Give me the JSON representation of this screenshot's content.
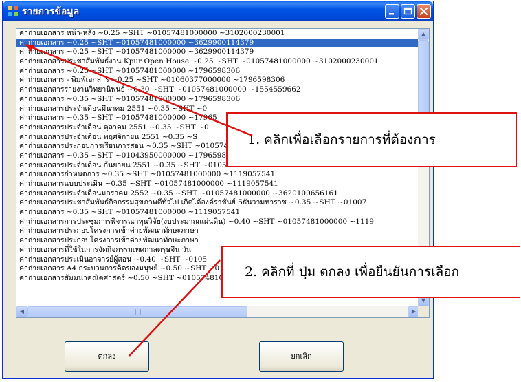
{
  "window": {
    "title": "รายการข้อมูล"
  },
  "list": {
    "selected_index": 1,
    "items": [
      "ค่าถ่ายเอกสาร หน้า-หลัง ~0.25 ~SHT ~01057481000000 ~3102000230001",
      "ค่าถ่ายเอกสาร ~0.25 ~SHT ~01057481000000 ~3629900114379",
      "ค่าถ่ายเอกสาร ~0.25 ~SHT ~01057481000000 ~3629900114379",
      "ค่าถ่ายเอกสารประชาสัมพันธ์งาน Kpur Open House ~0.25 ~SHT ~01057481000000 ~3102000230001",
      "ค่าถ่ายเอกสาร ~0.25 ~SHT ~01057481000000 ~1796598306",
      "ค่าถ่ายเอกสาร - พิมพ์เอกสาร ~0.25 ~SHT ~01060377000000 ~1796598306",
      "ค่าถ่ายเอกสารรายงานวิทยานิพนธ์ ~0.30 ~SHT ~01057481000000 ~1554559662",
      "ค่าถ่ายเอกสาร ~0.35 ~SHT ~01057481000000 ~1796598306",
      "ค่าถ่ายเอกสารประจำเดือนมีนาคม 2551 ~0.35 ~SHT ~0",
      "ค่าถ่ายเอกสาร ~0.35 ~SHT ~01057481000000 ~17965",
      "ค่าถ่ายเอกสารประจำเดือน ตุลาคม 2551 ~0.35 ~SHT ~0",
      "ค่าถ่ายเอกสารประจำเดือน พฤศจิกายน 2551 ~0.35 ~S",
      "ค่าถ่ายเอกสารประกอบการเรียนการสอน ~0.35 ~SHT ~01057481000000 ~1119057541",
      "ค่าถ่ายเอกสาร ~0.35 ~SHT ~01043950000000 ~1796598306",
      "ค่าถ่ายเอกสารประจำเดือน กันยายน 2551 ~0.35 ~SHT ~01057481000000 ~3620100656161",
      "ค่าถ่ายเอกสารกำหนดการ ~0.35 ~SHT ~01057481000000 ~1119057541",
      "ค่าถ่ายเอกสารแบบประเมิน ~0.35 ~SHT ~01057481000000 ~1119057541",
      "ค่าถ่ายเอกสารประจำเดือนมกราคม 2552 ~0.35 ~SHT ~01057481000000 ~3620100656161",
      "ค่าถ่ายเอกสารประชาสัมพันธ์กิจกรรมสุขภาพดีทั่วไป เกิดได้องค์ราชันย์ 5ธันวามหาราช ~0.35 ~SHT ~01007",
      "ค่าถ่ายเอกสาร ~0.35 ~SHT ~01057481000000 ~1119057541",
      "ค่าถ่ายเอกสารการประชุมการพิจารณาทุนวิจัย(งบประมาณแผ่นดิน) ~0.40 ~SHT ~01057481000000 ~1119",
      "ค่าถ่ายเอกสารประกอบโครงการเข้าค่ายพัฒนาทักษะภาษา",
      "ค่าถ่ายเอกสารประกอบโครงการเข้าค่ายพัฒนาทักษะภาษา",
      "ค่าถ่ายเอกสารที่ใช้ในการจัดกิจกรรมเทศกาลตรุษจีน วัน",
      "ค่าถ่ายเอกสารประเมินอาจารย์ผู้สอน ~0.40 ~SHT ~0105",
      "ค่าถ่ายเอกสาร A4 กระบวนการคิดของมนุษย์ ~0.50 ~SHT ~01057481000000 ~3650600408671",
      "ค่าถ่ายเอกสารสัมมนาคณิตศาสตร์ ~0.50 ~SHT ~01057481000000 ~1030769493"
    ]
  },
  "buttons": {
    "ok_label": "ตกลง",
    "cancel_label": "ยกเลิก"
  },
  "callouts": {
    "step1": "1. คลิกเพื่อเลือกรายการที่ต้องการ",
    "step2": "2. คลิกที่ ปุ่ม ตกลง เพื่อยืนยันการเลือก"
  },
  "colors": {
    "selection": "#316ac5",
    "annotation": "#e01010",
    "titlebar": "#0055e5"
  }
}
